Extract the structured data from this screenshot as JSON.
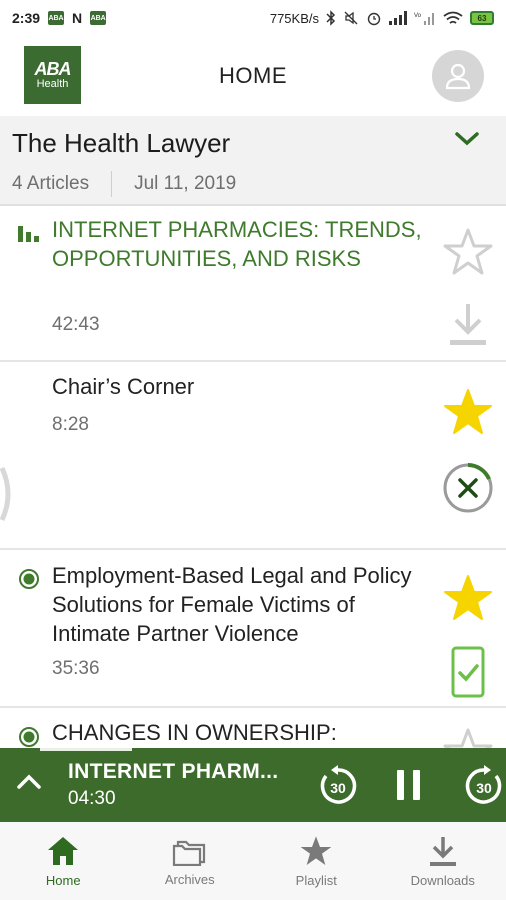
{
  "status_bar": {
    "time": "2:39",
    "network_speed": "775KB/s",
    "battery": "63"
  },
  "header": {
    "logo_line1": "ABA",
    "logo_line2": "Health",
    "title": "HOME"
  },
  "publication": {
    "title": "The Health Lawyer",
    "article_count": "4 Articles",
    "date": "Jul 11, 2019"
  },
  "articles": [
    {
      "title": "INTERNET PHARMACIES: TRENDS, OPPORTUNITIES, AND RISKS",
      "duration": "42:43",
      "state": "playing",
      "favorite": false,
      "download": "not-downloaded"
    },
    {
      "title": "Chair’s Corner",
      "duration": "8:28",
      "state": "none",
      "favorite": true,
      "download": "downloading"
    },
    {
      "title": "Employment-Based Legal and Policy Solutions for Female Victims of Intimate Partner Violence",
      "duration": "35:36",
      "state": "in-progress",
      "favorite": true,
      "download": "downloaded"
    },
    {
      "title": "CHANGES IN OWNERSHIP:",
      "duration": "",
      "state": "in-progress",
      "favorite": false,
      "download": "not-downloaded"
    }
  ],
  "player": {
    "title": "INTERNET PHARM...",
    "time": "04:30",
    "rewind_label": "30",
    "forward_label": "30"
  },
  "nav": {
    "home": "Home",
    "archives": "Archives",
    "playlist": "Playlist",
    "downloads": "Downloads"
  },
  "colors": {
    "brand_green": "#3c6b2b",
    "accent_green": "#3f7a2d",
    "star_yellow": "#f5d400",
    "download_check_green": "#6cc04a"
  }
}
